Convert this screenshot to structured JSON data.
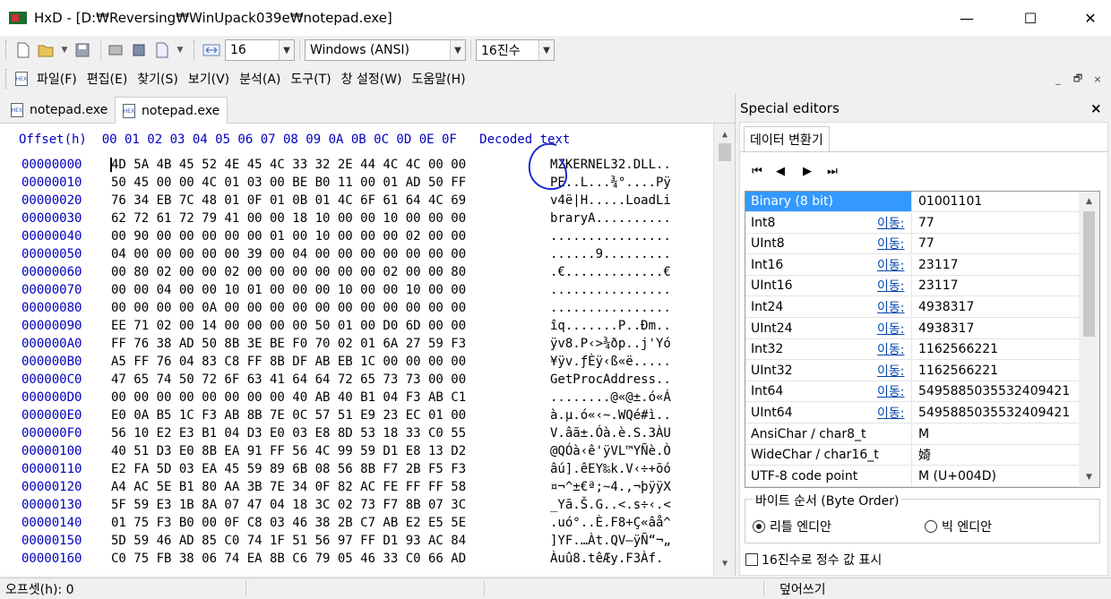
{
  "window": {
    "title": "HxD - [D:₩Reversing₩WinUpack039e₩notepad.exe]",
    "controls": [
      "—",
      "☐",
      "✕"
    ]
  },
  "toolbar": {
    "bytes_per_row": "16",
    "charset": "Windows (ANSI)",
    "offset_base": "16진수"
  },
  "menu": {
    "items": [
      "파일(F)",
      "편집(E)",
      "찾기(S)",
      "보기(V)",
      "분석(A)",
      "도구(T)",
      "창 설정(W)",
      "도움말(H)"
    ],
    "mdi_controls": [
      "_",
      "🗗",
      "×"
    ]
  },
  "tabs": [
    "notepad.exe",
    "notepad.exe"
  ],
  "hex": {
    "header": "Offset(h)  00 01 02 03 04 05 06 07 08 09 0A 0B 0C 0D 0E 0F   Decoded text",
    "rows": [
      {
        "offset": "00000000",
        "bytes": "4D 5A 4B 45 52 4E 45 4C 33 32 2E 44 4C 4C 00 00",
        "text": "MZKERNEL32.DLL.."
      },
      {
        "offset": "00000010",
        "bytes": "50 45 00 00 4C 01 03 00 BE B0 11 00 01 AD 50 FF",
        "text": "PE..L...¾°....Pÿ"
      },
      {
        "offset": "00000020",
        "bytes": "76 34 EB 7C 48 01 0F 01 0B 01 4C 6F 61 64 4C 69",
        "text": "v4ë|H.....LoadLi"
      },
      {
        "offset": "00000030",
        "bytes": "62 72 61 72 79 41 00 00 18 10 00 00 10 00 00 00",
        "text": "braryA.........."
      },
      {
        "offset": "00000040",
        "bytes": "00 90 00 00 00 00 00 01 00 10 00 00 00 02 00 00",
        "text": "................"
      },
      {
        "offset": "00000050",
        "bytes": "04 00 00 00 00 00 39 00 04 00 00 00 00 00 00 00",
        "text": "......9........."
      },
      {
        "offset": "00000060",
        "bytes": "00 80 02 00 00 02 00 00 00 00 00 00 02 00 00 80",
        "text": ".€.............€"
      },
      {
        "offset": "00000070",
        "bytes": "00 00 04 00 00 10 01 00 00 00 10 00 00 10 00 00",
        "text": "................"
      },
      {
        "offset": "00000080",
        "bytes": "00 00 00 00 0A 00 00 00 00 00 00 00 00 00 00 00",
        "text": "................"
      },
      {
        "offset": "00000090",
        "bytes": "EE 71 02 00 14 00 00 00 00 50 01 00 D0 6D 00 00",
        "text": "îq.......P..Ðm.."
      },
      {
        "offset": "000000A0",
        "bytes": "FF 76 38 AD 50 8B 3E BE F0 70 02 01 6A 27 59 F3",
        "text": "ÿv8.P‹>¾ðp..j'Yó"
      },
      {
        "offset": "000000B0",
        "bytes": "A5 FF 76 04 83 C8 FF 8B DF AB EB 1C 00 00 00 00",
        "text": "¥ÿv.ƒÈÿ‹ß«ë....."
      },
      {
        "offset": "000000C0",
        "bytes": "47 65 74 50 72 6F 63 41 64 64 72 65 73 73 00 00",
        "text": "GetProcAddress.."
      },
      {
        "offset": "000000D0",
        "bytes": "00 00 00 00 00 00 00 00 40 AB 40 B1 04 F3 AB C1",
        "text": "........@«@±.ó«Á"
      },
      {
        "offset": "000000E0",
        "bytes": "E0 0A B5 1C F3 AB 8B 7E 0C 57 51 E9 23 EC 01 00",
        "text": "à.µ.ó«‹~.WQé#ì.."
      },
      {
        "offset": "000000F0",
        "bytes": "56 10 E2 E3 B1 04 D3 E0 03 E8 8D 53 18 33 C0 55",
        "text": "V.âã±.Óà.è.S.3ÀU"
      },
      {
        "offset": "00000100",
        "bytes": "40 51 D3 E0 8B EA 91 FF 56 4C 99 59 D1 E8 13 D2",
        "text": "@QÓà‹ê'ÿVL™YÑè.Ò"
      },
      {
        "offset": "00000110",
        "bytes": "E2 FA 5D 03 EA 45 59 89 6B 08 56 8B F7 2B F5 F3",
        "text": "âú].êEY‰k.V‹÷+õó"
      },
      {
        "offset": "00000120",
        "bytes": "A4 AC 5E B1 80 AA 3B 7E 34 0F 82 AC FE FF FF 58",
        "text": "¤¬^±€ª;~4.‚¬þÿÿX"
      },
      {
        "offset": "00000130",
        "bytes": "5F 59 E3 1B 8A 07 47 04 18 3C 02 73 F7 8B 07 3C",
        "text": "_Yã.Š.G..<.s÷‹.<"
      },
      {
        "offset": "00000140",
        "bytes": "01 75 F3 B0 00 0F C8 03 46 38 2B C7 AB E2 E5 5E",
        "text": ".uó°..È.F8+Ç«âå^"
      },
      {
        "offset": "00000150",
        "bytes": "5D 59 46 AD 85 C0 74 1F 51 56 97 FF D1 93 AC 84",
        "text": "]YF.…Àt.QV—ÿÑ“¬„"
      },
      {
        "offset": "00000160",
        "bytes": "C0 75 FB 38 06 74 EA 8B C6 79 05 46 33 C0 66 AD",
        "text": "Àuû8.têÆy.F3Àf."
      }
    ]
  },
  "special_editors": {
    "title": "Special editors",
    "close": "×",
    "tab": "데이터 변환기",
    "nav": [
      "⏮",
      "◀",
      "▶",
      "⏭"
    ],
    "goto_label": "이동:",
    "rows": [
      {
        "name": "Binary (8 bit)",
        "goto": false,
        "value": "01001101"
      },
      {
        "name": "Int8",
        "goto": true,
        "value": "77"
      },
      {
        "name": "UInt8",
        "goto": true,
        "value": "77"
      },
      {
        "name": "Int16",
        "goto": true,
        "value": "23117"
      },
      {
        "name": "UInt16",
        "goto": true,
        "value": "23117"
      },
      {
        "name": "Int24",
        "goto": true,
        "value": "4938317"
      },
      {
        "name": "UInt24",
        "goto": true,
        "value": "4938317"
      },
      {
        "name": "Int32",
        "goto": true,
        "value": "1162566221"
      },
      {
        "name": "UInt32",
        "goto": true,
        "value": "1162566221"
      },
      {
        "name": "Int64",
        "goto": true,
        "value": "5495885035532409421"
      },
      {
        "name": "UInt64",
        "goto": true,
        "value": "5495885035532409421"
      },
      {
        "name": "AnsiChar / char8_t",
        "goto": false,
        "value": "M"
      },
      {
        "name": "WideChar / char16_t",
        "goto": false,
        "value": "婍"
      },
      {
        "name": "UTF-8 code point",
        "goto": false,
        "value": "M (U+004D)"
      }
    ],
    "byte_order": {
      "legend": "바이트 순서 (Byte Order)",
      "little": "리틀 엔디안",
      "big": "빅 엔디안"
    },
    "hex_int_label": "16진수로 정수 값 표시"
  },
  "status": {
    "offset": "오프셋(h): 0",
    "mode": "덮어쓰기"
  }
}
